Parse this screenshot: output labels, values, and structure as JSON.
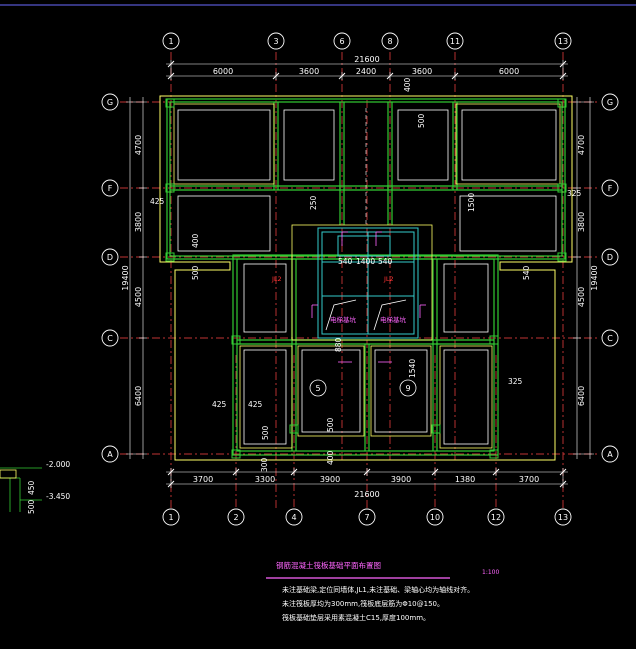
{
  "colors": {
    "background": "#000000",
    "grid_axis": "#ff4444",
    "wall": "#33cc33",
    "foundation": "#ffff66",
    "dimension": "#ffffff",
    "title": "#ff66ff",
    "core": "#33cccc"
  },
  "axes_top": [
    "1",
    "3",
    "6",
    "8",
    "11",
    "13"
  ],
  "axes_bottom": [
    "1",
    "2",
    "4",
    "7",
    "10",
    "12",
    "13"
  ],
  "axes_left": [
    "G",
    "F",
    "D",
    "C",
    "A"
  ],
  "axes_right": [
    "G",
    "F",
    "D",
    "C",
    "A"
  ],
  "dims_top_total": "21600",
  "dims_top": [
    "6000",
    "3600",
    "2400",
    "3600",
    "6000"
  ],
  "dims_bottom": [
    "3700",
    "3300",
    "3900",
    "3900",
    "1380",
    "3700"
  ],
  "dims_bottom_total": "21600",
  "dims_left": [
    "4700",
    "3800",
    "4500",
    "6400"
  ],
  "dims_left_total": "19400",
  "dims_right": [
    "4700",
    "3800",
    "4500",
    "6400"
  ],
  "dims_right_total": "19400",
  "labels": {
    "dim_425_left": "425",
    "dim_325_right": "325",
    "dim_325_mid": "325",
    "dim_425_a": "425",
    "dim_425_b": "425",
    "dim_400_top": "400",
    "dim_500_a": "500",
    "dim_500_b": "500",
    "dim_250": "250",
    "dim_1500": "1500",
    "dim_400_c": "400",
    "dim_500_c": "500",
    "dim_300": "300",
    "dim_400_d": "400",
    "dim_500_d": "500",
    "dim_540": "540",
    "dim_880": "880",
    "dim_1540": "1540",
    "core_dims": [
      "540",
      "1400",
      "540"
    ],
    "jl2_a": "JL2",
    "jl2_b": "JL2",
    "elev_a": "电梯基坑",
    "elev_b": "电梯基坑",
    "axis_5": "5",
    "axis_9": "9",
    "side_a": "-2.000",
    "side_b": "-3.450",
    "side_c": "450",
    "side_d": "500"
  },
  "title": "钢筋混凝土筏板基础平面布置图",
  "scale": "1:100",
  "notes": [
    "未注基础梁,定位同墙体,JL1,未注基础、梁轴心均为轴线对齐。",
    "未注筏板厚均为300mm,筏板底层筋为Φ10@150。",
    "筏板基础垫层采用素混凝土C15,厚度100mm。"
  ]
}
